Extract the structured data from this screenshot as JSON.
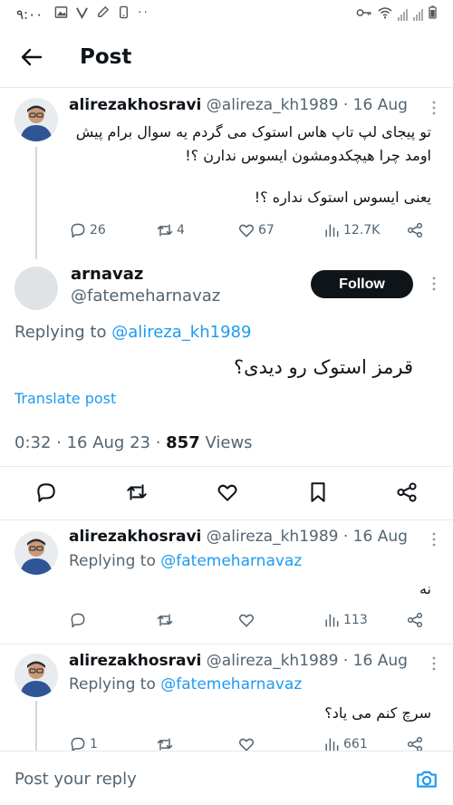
{
  "status_bar": {
    "time": "۹:۰۰"
  },
  "header": {
    "title": "Post"
  },
  "tweets": [
    {
      "name": "alirezakhosravi",
      "meta": "@alireza_kh1989 · 16 Aug",
      "text_line1": "تو پیجای لپ تاپ هاس استوک می گردم یه سوال برام پیش",
      "text_line2": "اومد چرا هیچکدومشون ایسوس ندارن ؟!",
      "text_line3": "یعنی ایسوس استوک نداره ؟!",
      "replies": "26",
      "retweets": "4",
      "likes": "67",
      "views": "12.7K"
    },
    {
      "name": "alirezakhosravi",
      "meta": "@alireza_kh1989 · 16 Aug",
      "replying_prefix": "Replying to ",
      "replying_to": "@fatemeharnavaz",
      "text": "نه",
      "views": "113"
    },
    {
      "name": "alirezakhosravi",
      "meta": "@alireza_kh1989 · 16 Aug",
      "replying_prefix": "Replying to ",
      "replying_to": "@fatemeharnavaz",
      "text": "سرچ کنم می یاد؟",
      "replies": "1",
      "views": "661"
    }
  ],
  "main_post": {
    "name": "arnavaz",
    "handle": "@fatemeharnavaz",
    "follow_label": "Follow",
    "replying_prefix": "Replying to ",
    "replying_to": "@alireza_kh1989",
    "text": "قرمز استوک رو دیدی؟",
    "translate_label": "Translate post",
    "timestamp": "0:32 · 16 Aug 23 · ",
    "views_count": "857",
    "views_label": " Views"
  },
  "reply_bar": {
    "placeholder": "Post your reply"
  },
  "colors": {
    "accent": "#1d9bf0",
    "text": "#0f1419",
    "muted": "#536471"
  }
}
